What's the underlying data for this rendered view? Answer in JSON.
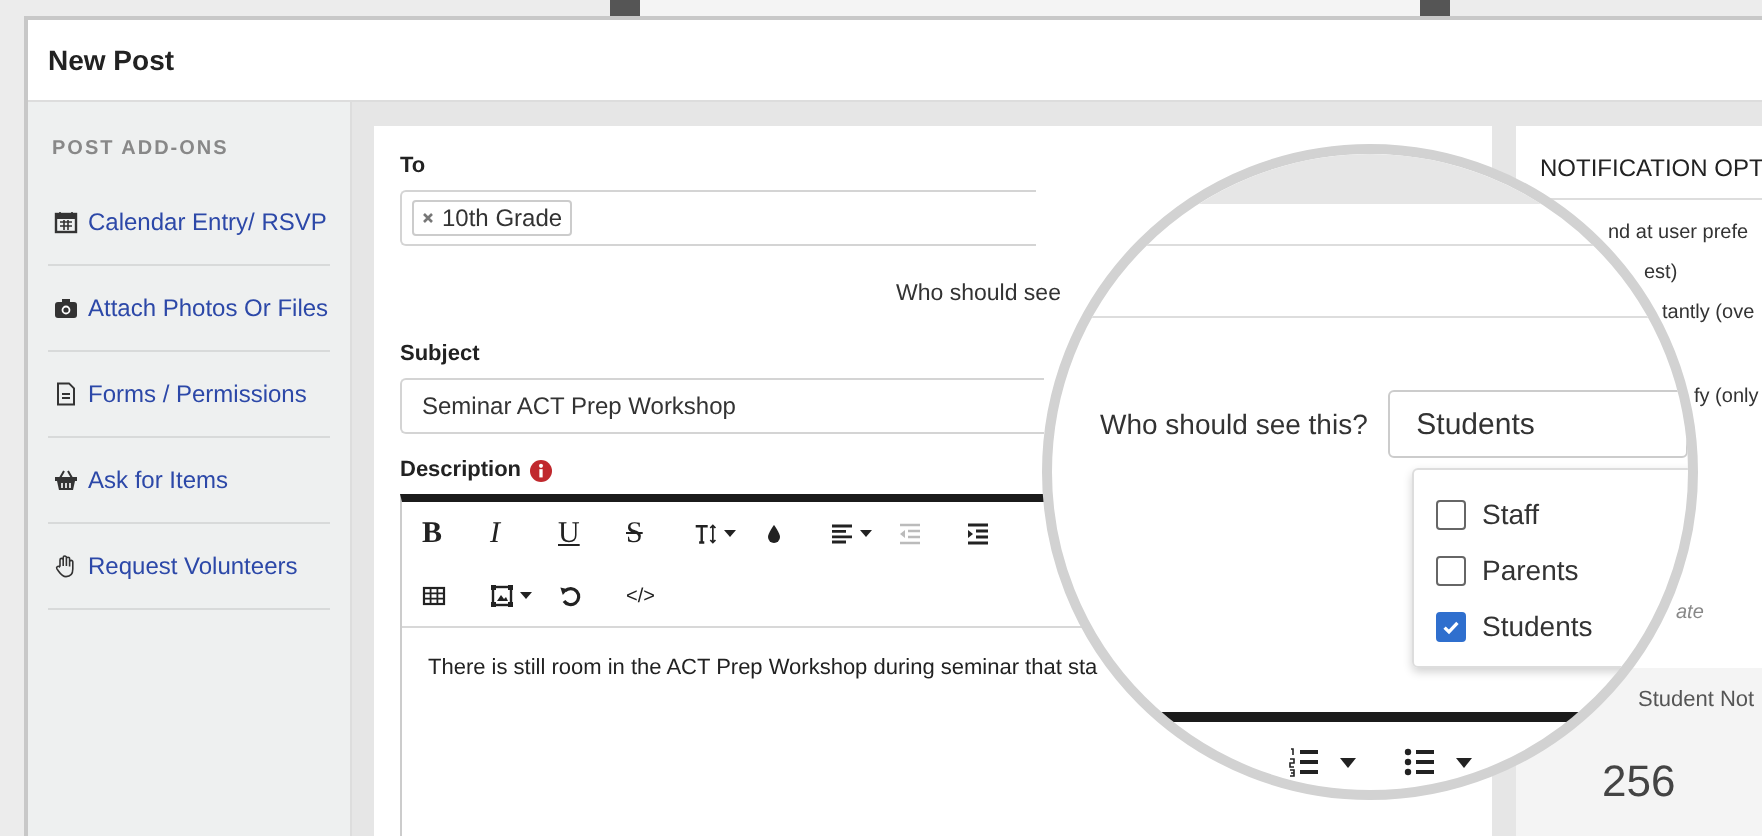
{
  "window": {
    "title": "New Post"
  },
  "sidebar": {
    "heading": "POST ADD-ONS",
    "items": [
      {
        "label": "Calendar Entry/ RSVP",
        "kind": "calendar"
      },
      {
        "label": "Attach Photos Or Files",
        "kind": "camera"
      },
      {
        "label": "Forms / Permissions",
        "kind": "document"
      },
      {
        "label": "Ask for Items",
        "kind": "basket"
      },
      {
        "label": "Request Volunteers",
        "kind": "hand"
      }
    ]
  },
  "form": {
    "to_label": "To",
    "recipients": [
      "10th Grade"
    ],
    "visibility_label": "Who should see",
    "subject_label": "Subject",
    "subject_value": "Seminar ACT Prep Workshop",
    "description_label": "Description",
    "toolbar_rows": [
      [
        {
          "kind": "bold",
          "text": "B",
          "caret": false,
          "disabled": false
        },
        {
          "kind": "italic",
          "text": "I",
          "caret": false,
          "disabled": false
        },
        {
          "kind": "underline",
          "text": "U",
          "caret": false,
          "disabled": false
        },
        {
          "kind": "strike",
          "text": "S",
          "caret": false,
          "disabled": false
        },
        {
          "kind": "fontsize",
          "caret": true,
          "disabled": false
        },
        {
          "kind": "drop",
          "caret": false,
          "disabled": false
        },
        {
          "kind": "align",
          "caret": true,
          "disabled": false
        },
        {
          "kind": "outdent",
          "caret": false,
          "disabled": true
        },
        {
          "kind": "indent",
          "caret": false,
          "disabled": false
        }
      ],
      [
        {
          "kind": "table",
          "caret": false,
          "disabled": false
        },
        {
          "kind": "image",
          "caret": true,
          "disabled": false
        },
        {
          "kind": "undo",
          "caret": false,
          "disabled": false
        },
        {
          "kind": "code",
          "text": "</>",
          "caret": false,
          "disabled": false
        }
      ]
    ],
    "body": "There is still room in the ACT Prep Workshop during seminar that sta"
  },
  "magnifier": {
    "label": "Who should see this?",
    "select_value": "Students",
    "options": [
      {
        "label": "Staff",
        "checked": false
      },
      {
        "label": "Parents",
        "checked": false
      },
      {
        "label": "Students",
        "checked": true
      }
    ]
  },
  "notifications": {
    "title": "NOTIFICATION OPT",
    "lines": [
      "nd at user prefe",
      "est)",
      "tantly (ove",
      "fy (only"
    ],
    "note": "ate",
    "stat_title": "Student Not",
    "stat_value": "256"
  }
}
